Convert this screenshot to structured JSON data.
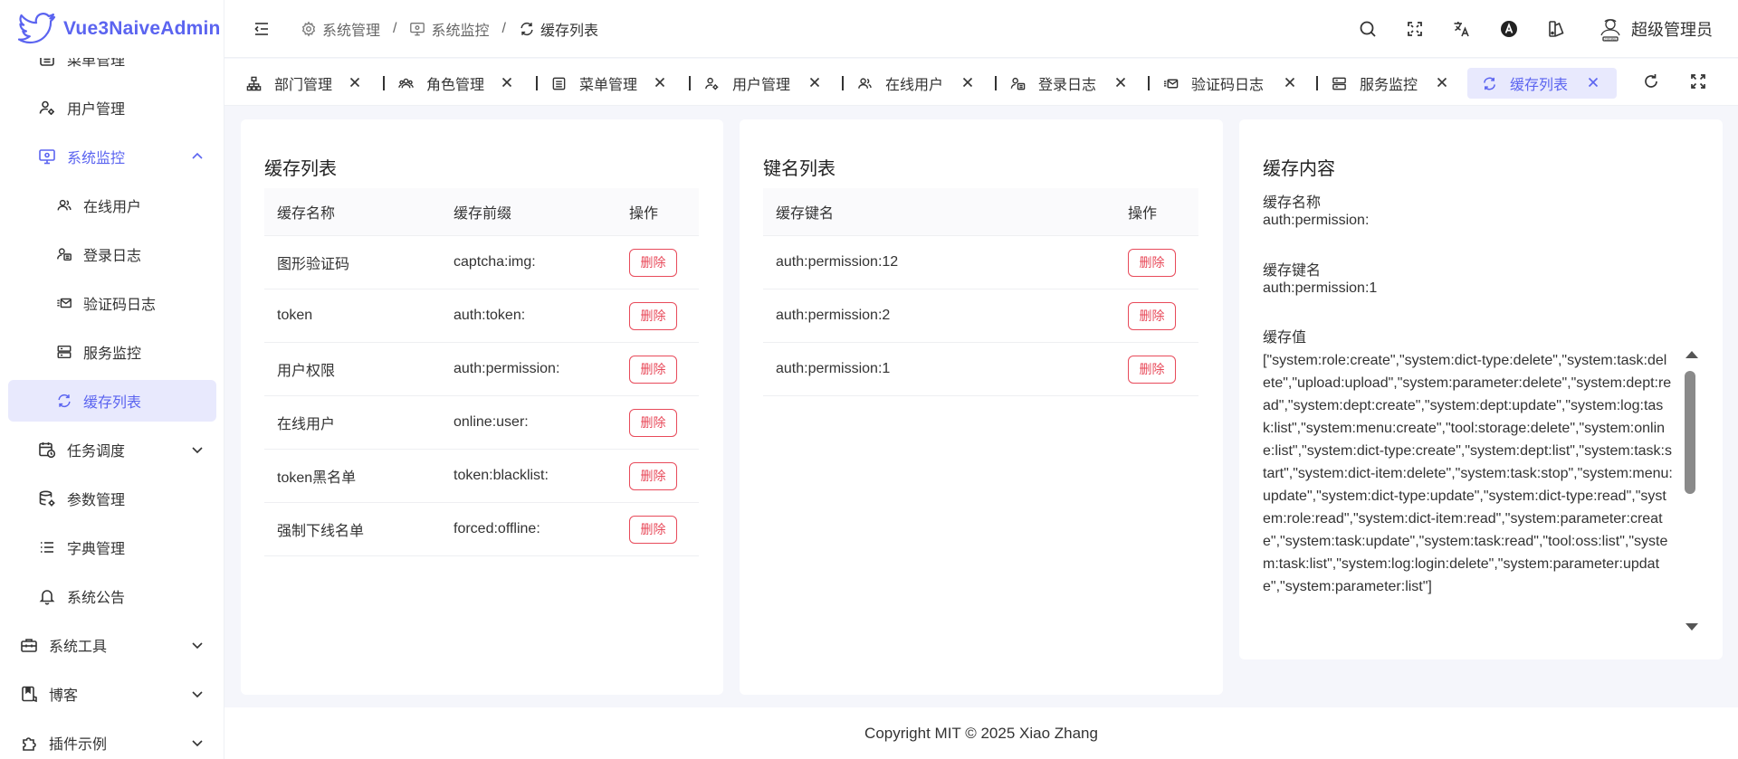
{
  "brand": {
    "title": "Vue3NaiveAdmin"
  },
  "sidebar": {
    "items": [
      {
        "label": "菜单管理",
        "icon": "menu-list-icon"
      },
      {
        "label": "用户管理",
        "icon": "user-settings-icon"
      },
      {
        "label": "系统监控",
        "icon": "monitor-icon",
        "expanded": true
      },
      {
        "label": "在线用户",
        "icon": "users-online-icon"
      },
      {
        "label": "登录日志",
        "icon": "login-log-icon"
      },
      {
        "label": "验证码日志",
        "icon": "mail-icon"
      },
      {
        "label": "服务监控",
        "icon": "server-icon"
      },
      {
        "label": "缓存列表",
        "icon": "refresh-icon",
        "active": true
      },
      {
        "label": "任务调度",
        "icon": "calendar-clock-icon"
      },
      {
        "label": "参数管理",
        "icon": "database-settings-icon"
      },
      {
        "label": "字典管理",
        "icon": "list-icon"
      },
      {
        "label": "系统公告",
        "icon": "bell-icon"
      },
      {
        "label": "系统工具",
        "icon": "toolbox-icon"
      },
      {
        "label": "博客",
        "icon": "blog-icon"
      },
      {
        "label": "插件示例",
        "icon": "plugin-icon"
      }
    ]
  },
  "header": {
    "breadcrumb": [
      {
        "label": "系统管理",
        "icon": "gear-icon"
      },
      {
        "label": "系统监控",
        "icon": "monitor-icon"
      },
      {
        "label": "缓存列表",
        "icon": "refresh-icon"
      }
    ],
    "separator": "/",
    "user_name": "超级管理员"
  },
  "tabs": [
    {
      "label": "部门管理",
      "icon": "org-icon"
    },
    {
      "label": "角色管理",
      "icon": "users-icon"
    },
    {
      "label": "菜单管理",
      "icon": "menu-list-icon"
    },
    {
      "label": "用户管理",
      "icon": "user-settings-icon"
    },
    {
      "label": "在线用户",
      "icon": "users-online-icon"
    },
    {
      "label": "登录日志",
      "icon": "login-log-icon"
    },
    {
      "label": "验证码日志",
      "icon": "mail-icon"
    },
    {
      "label": "服务监控",
      "icon": "server-icon"
    },
    {
      "label": "缓存列表",
      "icon": "refresh-icon",
      "active": true
    }
  ],
  "cache_list": {
    "title": "缓存列表",
    "columns": [
      "缓存名称",
      "缓存前缀",
      "操作"
    ],
    "rows": [
      {
        "name": "图形验证码",
        "prefix": "captcha:img:"
      },
      {
        "name": "token",
        "prefix": "auth:token:"
      },
      {
        "name": "用户权限",
        "prefix": "auth:permission:"
      },
      {
        "name": "在线用户",
        "prefix": "online:user:"
      },
      {
        "name": "token黑名单",
        "prefix": "token:blacklist:"
      },
      {
        "name": "强制下线名单",
        "prefix": "forced:offline:"
      }
    ],
    "delete_label": "删除"
  },
  "key_list": {
    "title": "键名列表",
    "columns": [
      "缓存键名",
      "操作"
    ],
    "rows": [
      {
        "key": "auth:permission:12"
      },
      {
        "key": "auth:permission:2"
      },
      {
        "key": "auth:permission:1"
      }
    ],
    "delete_label": "删除"
  },
  "cache_content": {
    "title": "缓存内容",
    "name_label": "缓存名称",
    "name_value": "auth:permission:",
    "key_label": "缓存键名",
    "key_value": "auth:permission:1",
    "value_label": "缓存值",
    "value_text": "[\"system:role:create\",\"system:dict-type:delete\",\"system:task:delete\",\"upload:upload\",\"system:parameter:delete\",\"system:dept:read\",\"system:dept:create\",\"system:dept:update\",\"system:log:task:list\",\"system:menu:create\",\"tool:storage:delete\",\"system:online:list\",\"system:dict-type:create\",\"system:dept:list\",\"system:task:start\",\"system:dict-item:delete\",\"system:task:stop\",\"system:menu:update\",\"system:dict-type:update\",\"system:dict-type:read\",\"system:role:read\",\"system:dict-item:read\",\"system:parameter:create\",\"system:task:update\",\"system:task:read\",\"tool:oss:list\",\"system:task:list\",\"system:log:login:delete\",\"system:parameter:update\",\"system:parameter:list\"]"
  },
  "footer": {
    "text": "Copyright MIT © 2025 Xiao Zhang"
  },
  "colors": {
    "accent": "#5b64f0",
    "danger": "#e84a5a",
    "active_bg": "#e8e9fd"
  }
}
